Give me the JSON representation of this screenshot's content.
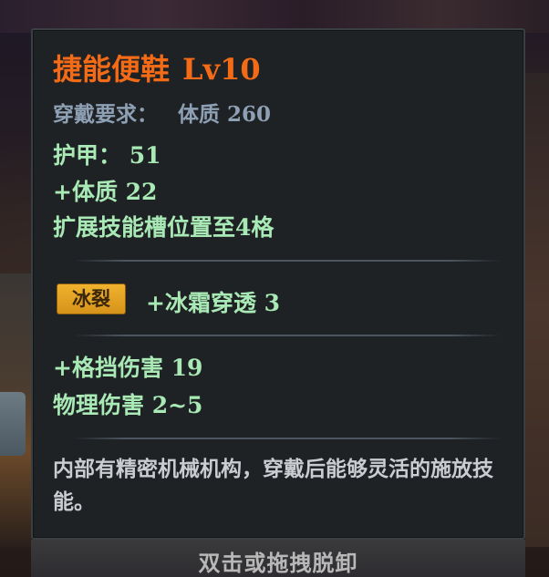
{
  "item": {
    "name": "捷能便鞋",
    "level": "Lv10",
    "requirement_label": "穿戴要求：",
    "requirement_value": "体质  260"
  },
  "base_stats": [
    "护甲：  51",
    "+体质  22",
    "扩展技能槽位置至4格"
  ],
  "enchant": {
    "tag": "冰裂",
    "effect": "+冰霜穿透  3"
  },
  "extra_stats": [
    "+格挡伤害  19",
    "物理伤害  2~5"
  ],
  "description": "内部有精密机械机构，穿戴后能够灵活的施放技能。",
  "hint": "双击或拖拽脱卸",
  "colors": {
    "name": "#f36b16",
    "requirement": "#8ea0b4",
    "stat": "#a8e9b5",
    "tag_bg": "#e3a224",
    "description": "#c9cdd1",
    "panel_bg": "#1f2225"
  }
}
